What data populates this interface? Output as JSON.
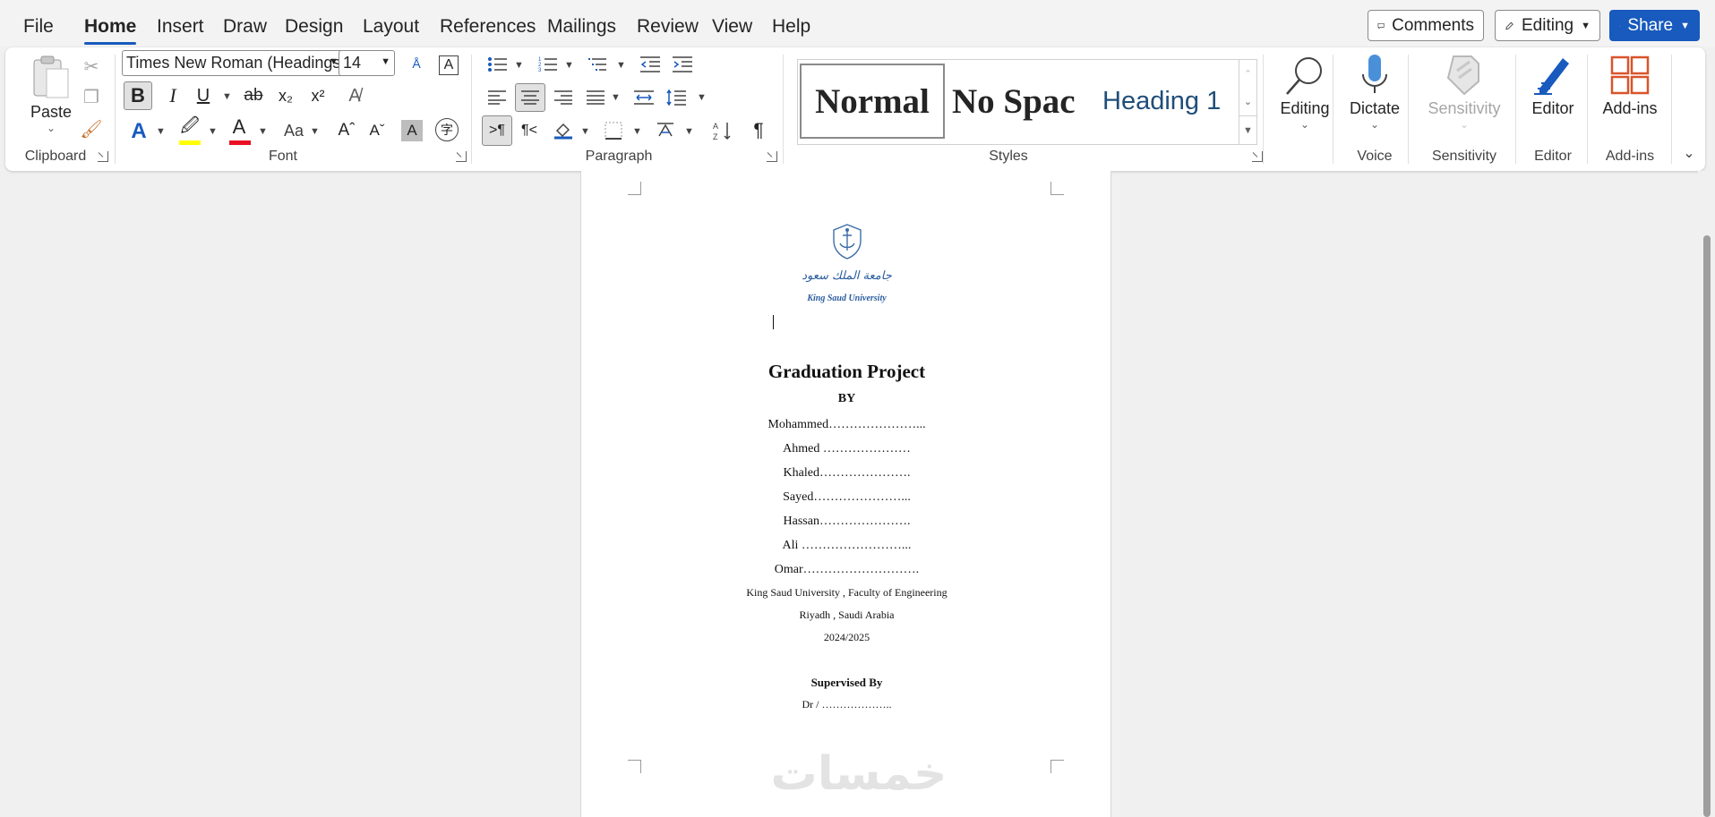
{
  "menu": {
    "tabs": [
      "File",
      "Home",
      "Insert",
      "Draw",
      "Design",
      "Layout",
      "References",
      "Mailings",
      "Review",
      "View",
      "Help"
    ],
    "active_tab": "Home",
    "comments_label": "Comments",
    "editing_label": "Editing",
    "share_label": "Share"
  },
  "ribbon": {
    "clipboard": {
      "label": "Clipboard",
      "paste_label": "Paste"
    },
    "font": {
      "label": "Font",
      "font_name": "Times New Roman (Headings)",
      "font_size": "14",
      "size_options": [
        "14"
      ]
    },
    "paragraph": {
      "label": "Paragraph"
    },
    "styles": {
      "label": "Styles",
      "items": [
        "Normal",
        "No Spac",
        "Heading 1"
      ]
    },
    "editing": {
      "label": "Editing"
    },
    "voice": {
      "label": "Voice",
      "dictate_label": "Dictate"
    },
    "sensitivity": {
      "label": "Sensitivity",
      "button_label": "Sensitivity"
    },
    "editor": {
      "label": "Editor",
      "button_label": "Editor"
    },
    "addins": {
      "label": "Add-ins",
      "button_label": "Add-ins"
    }
  },
  "document": {
    "logo_arabic": "جامعة الملك سعود",
    "logo_english": "King Saud University",
    "title": "Graduation Project",
    "by": "BY",
    "members": [
      "Mohammed…………………...",
      "Ahmed …………………",
      "Khaled………………….",
      "Sayed…………………...",
      "Hassan………………….",
      "Ali ……………………...",
      "Omar………………………."
    ],
    "university": "King Saud University ,  Faculty of Engineering",
    "location": "Riyadh , Saudi Arabia",
    "year": "2024/2025",
    "supervised_by": "Supervised By",
    "supervisor": "Dr / ………………..",
    "watermark": "خمسات"
  },
  "colors": {
    "accent": "#185abd",
    "highlight": "#ffff00",
    "font_color": "#e81123"
  }
}
